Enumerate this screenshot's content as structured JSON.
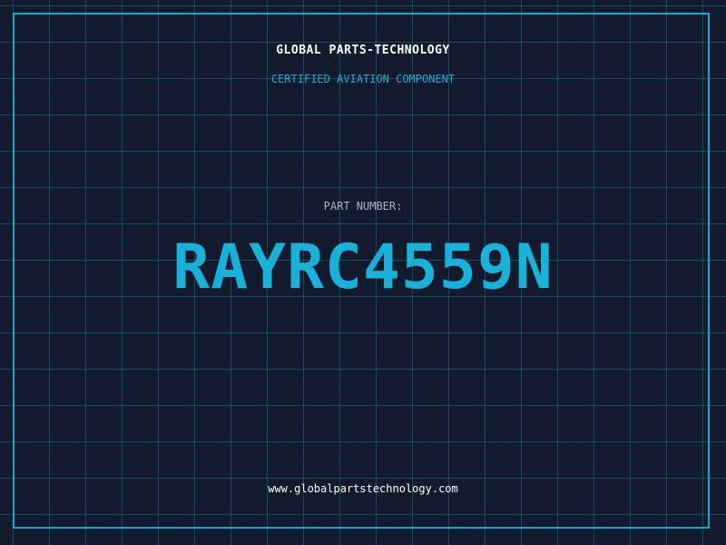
{
  "company": "GLOBAL PARTS-TECHNOLOGY",
  "tagline": "CERTIFIED AVIATION COMPONENT",
  "part": {
    "label": "PART NUMBER:",
    "number": "RAYRC4559N"
  },
  "website": "www.globalpartstechnology.com",
  "colors": {
    "background": "#121a2e",
    "grid": "#1e708c",
    "accent": "#1ab0d8",
    "frame": "#19a6cc"
  }
}
